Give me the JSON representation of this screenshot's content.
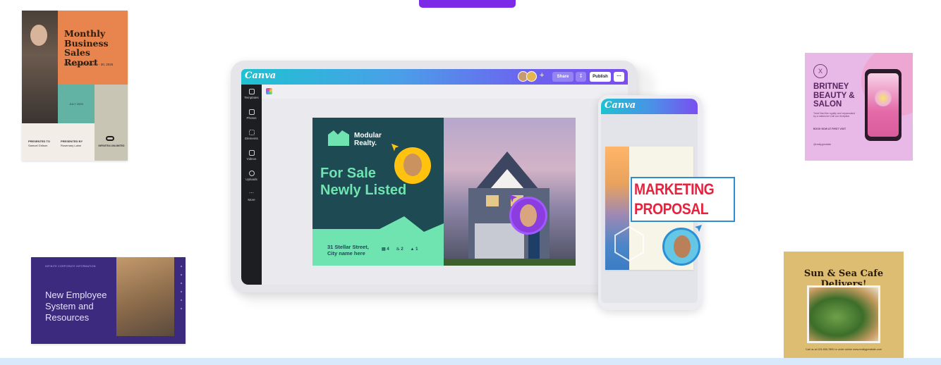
{
  "page": {
    "accent": "#7d2ae8",
    "band_color": "#d8e9fb"
  },
  "top_cta": {
    "label": ""
  },
  "cards": {
    "report": {
      "title": "Monthly Business Sales Report",
      "subtitle": "For the period of June 1 - 30, 2025",
      "teal_label": "JULY 2025",
      "presented_to_label": "PRESENTED TO",
      "presented_to_name": "Samuel Grilson",
      "presented_by_label": "PRESENTED BY",
      "presented_by_name": "Rosemary Laine",
      "brand": "INFINITEA UNLIMITED",
      "colors": {
        "orange": "#e8844d",
        "teal": "#62b3a3",
        "grey": "#c9c5b5"
      }
    },
    "employee": {
      "tiny_caption": "INFINITE CORPORATE INFORMATION",
      "title": "New Employee System and Resources",
      "background": "#3b2a7e"
    },
    "britney": {
      "logo_letter": "X",
      "title": "BRITNEY BEAUTY & SALON",
      "tagline": "Treat Dad like royalty and rejuvenated by a makeover Call our reception",
      "cta": "BOOK NOW AT FIRST VISIT",
      "handle": "@reallygreatsite",
      "background": "#e8b8e6"
    },
    "sun_sea": {
      "title": "Sun & Sea Cafe Delivers!",
      "footer": "Call us at 123-456-7890 or order online www.reallygreatsite.com",
      "background": "#dcbd72"
    }
  },
  "editor": {
    "logo": "Canva",
    "share_label": "Share",
    "download_icon": "download-icon",
    "publish_label": "Publish",
    "more_label": "…",
    "plus_label": "+",
    "sidebar": [
      {
        "label": "Templates",
        "icon": "templates-icon"
      },
      {
        "label": "Photos",
        "icon": "photos-icon"
      },
      {
        "label": "Elements",
        "icon": "elements-icon"
      },
      {
        "label": "Videos",
        "icon": "videos-icon"
      },
      {
        "label": "Uploads",
        "icon": "uploads-icon"
      },
      {
        "label": "More",
        "icon": "more-icon"
      }
    ],
    "design": {
      "brand_line1": "Modular",
      "brand_line2": "Realty.",
      "headline_line1": "For Sale",
      "headline_line2": "Newly Listed",
      "address_line1": "31 Stellar Street,",
      "address_line2": "City name here",
      "beds": "4",
      "baths": "2",
      "cars": "1",
      "colors": {
        "dark": "#1e4a53",
        "mint": "#6fe3b0"
      }
    }
  },
  "phone": {
    "logo": "Canva",
    "doc_title_line1": "MARKETING",
    "doc_title_line2": "PROPOSAL",
    "colors": {
      "title": "#e8213d",
      "frame": "#2b8fd6"
    }
  }
}
